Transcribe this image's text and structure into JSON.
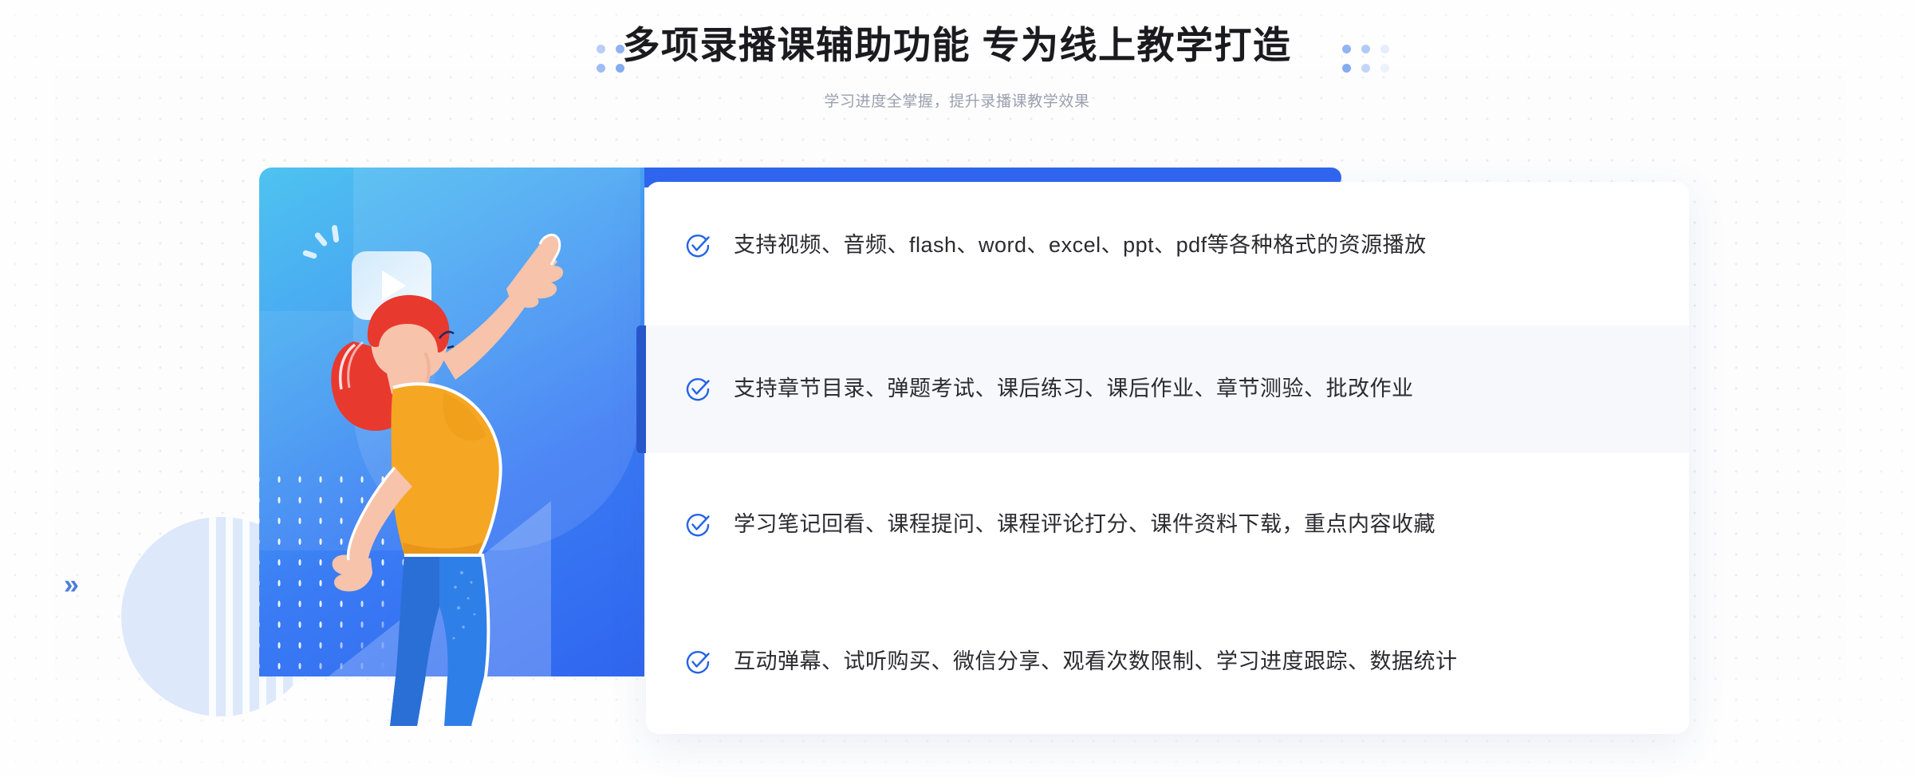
{
  "header": {
    "title": "多项录播课辅助功能 专为线上教学打造",
    "subtitle": "学习进度全掌握，提升录播课教学效果"
  },
  "decor": {
    "chevron_right": "»",
    "chevron_left": "«"
  },
  "colors": {
    "accent_blue": "#2f66ef",
    "check_blue": "#2563e6",
    "panel_blue_start": "#4ec3f0",
    "panel_blue_end": "#2f66ef",
    "title_text": "#1b1b1f",
    "subtitle_text": "#9aa0ae",
    "item_text": "#2b2b30",
    "row_highlight": "#f7f8fc",
    "deco_circle": "#dde8fb",
    "shirt_yellow": "#f5a623",
    "hair_red": "#e8392f",
    "jeans_blue": "#2f7fe8",
    "shoe_navy": "#1b2a5e",
    "skin": "#f7c3ab"
  },
  "features": [
    {
      "icon": "check-circle-icon",
      "text": "支持视频、音频、flash、word、excel、ppt、pdf等各种格式的资源播放",
      "highlighted": false
    },
    {
      "icon": "check-circle-icon",
      "text": "支持章节目录、弹题考试、课后练习、课后作业、章节测验、批改作业",
      "highlighted": true
    },
    {
      "icon": "check-circle-icon",
      "text": "学习笔记回看、课程提问、课程评论打分、课件资料下载，重点内容收藏",
      "highlighted": false
    },
    {
      "icon": "check-circle-icon",
      "text": "互动弹幕、试听购买、微信分享、观看次数限制、学习进度跟踪、数据统计",
      "highlighted": false
    }
  ],
  "illustration": {
    "name": "woman-pointing-at-video-illustration",
    "bubble_icon": "play-button-icon"
  }
}
